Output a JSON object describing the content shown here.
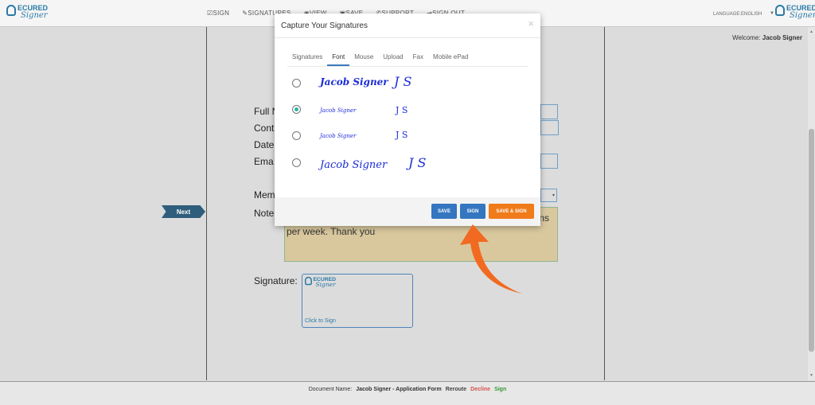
{
  "header": {
    "logo_line1": "ECURED",
    "logo_line2": "Signer",
    "nav": [
      {
        "icon": "edit-icon",
        "glyph": "☑",
        "label": "SIGN"
      },
      {
        "icon": "pen-icon",
        "glyph": "✎",
        "label": "SIGNATURES"
      },
      {
        "icon": "eye-icon",
        "glyph": "◉",
        "label": "VIEW"
      },
      {
        "icon": "save-icon",
        "glyph": "▣",
        "label": "SAVE"
      },
      {
        "icon": "phone-icon",
        "glyph": "✆",
        "label": "SUPPORT"
      },
      {
        "icon": "signout-icon",
        "glyph": "⇥",
        "label": "SIGN OUT"
      }
    ],
    "language": "LANGUAGE:ENGLISH"
  },
  "welcome": {
    "prefix": "Welcome:",
    "name": "Jacob Signer"
  },
  "next_label": "Next",
  "form": {
    "full_name": "Full N",
    "contact": "Cont",
    "date": "Date",
    "email": "Ema",
    "member": "Mem",
    "notes": "Note",
    "notes_text_1": "ns",
    "notes_text_2": "per week. Thank you",
    "signature": "Signature:",
    "click_to_sign": "Click to Sign"
  },
  "modal": {
    "title": "Capture Your Signatures",
    "close": "×",
    "tabs": [
      "Signatures",
      "Font",
      "Mouse",
      "Upload",
      "Fax",
      "Mobile ePad"
    ],
    "active_tab": "Font",
    "options": [
      {
        "name": "Jacob Signer",
        "initials": "J S",
        "selected": false
      },
      {
        "name": "Jacob Signer",
        "initials": "J S",
        "selected": true
      },
      {
        "name": "Jacob Signer",
        "initials": "J S",
        "selected": false
      },
      {
        "name": "Jacob Signer",
        "initials": "J S",
        "selected": false
      }
    ],
    "buttons": {
      "save": "SAVE",
      "sign": "SIGN",
      "save_sign": "SAVE & SIGN"
    }
  },
  "footer": {
    "label": "Document Name:",
    "doc_name": "Jacob Signer - Application Form",
    "reroute": "Reroute",
    "decline": "Decline",
    "sign": "Sign"
  },
  "colors": {
    "accent": "#3476c0",
    "orange": "#f07b1b",
    "arrow": "#f26a21",
    "next_bg": "#2f5d7c",
    "signature_ink": "#1b2cd8"
  }
}
